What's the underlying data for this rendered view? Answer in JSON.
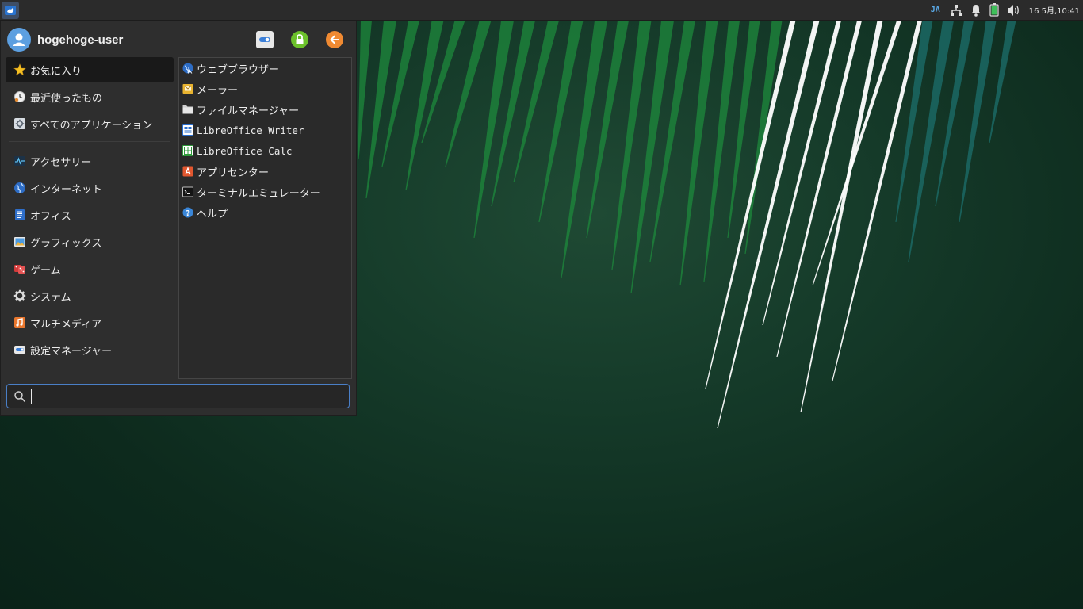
{
  "panel": {
    "input_method": "JA",
    "clock": "16 5月,10:41",
    "icons": [
      "xfce-logo-icon",
      "network-icon",
      "bell-icon",
      "battery-icon",
      "volume-icon"
    ]
  },
  "menu": {
    "username": "hogehoge-user",
    "header_icons": [
      "settings-icon",
      "lock-icon",
      "logout-icon"
    ],
    "categories_top": [
      {
        "label": "お気に入り",
        "icon": "star-icon",
        "active": true
      },
      {
        "label": "最近使ったもの",
        "icon": "recent-icon"
      },
      {
        "label": "すべてのアプリケーション",
        "icon": "all-apps-icon"
      }
    ],
    "categories": [
      {
        "label": "アクセサリー",
        "icon": "accessories-icon"
      },
      {
        "label": "インターネット",
        "icon": "internet-icon"
      },
      {
        "label": "オフィス",
        "icon": "office-icon"
      },
      {
        "label": "グラフィックス",
        "icon": "graphics-icon"
      },
      {
        "label": "ゲーム",
        "icon": "games-icon"
      },
      {
        "label": "システム",
        "icon": "system-icon"
      },
      {
        "label": "マルチメディア",
        "icon": "multimedia-icon"
      },
      {
        "label": "設定マネージャー",
        "icon": "settings-manager-icon"
      }
    ],
    "apps": [
      {
        "label": "ウェブブラウザー",
        "icon": "web-browser-icon"
      },
      {
        "label": "メーラー",
        "icon": "mail-icon"
      },
      {
        "label": "ファイルマネージャー",
        "icon": "folder-icon"
      },
      {
        "label": "LibreOffice Writer",
        "icon": "writer-icon"
      },
      {
        "label": "LibreOffice Calc",
        "icon": "calc-icon"
      },
      {
        "label": "アプリセンター",
        "icon": "app-center-icon"
      },
      {
        "label": "ターミナルエミュレーター",
        "icon": "terminal-icon"
      },
      {
        "label": "ヘルプ",
        "icon": "help-icon"
      }
    ],
    "search": {
      "value": "",
      "placeholder": ""
    }
  },
  "colors": {
    "accent": "#4a7fc7",
    "desktop_bg": "#153a29",
    "stripe_green": "#1e8a3c",
    "stripe_teal": "#1b6b68"
  }
}
